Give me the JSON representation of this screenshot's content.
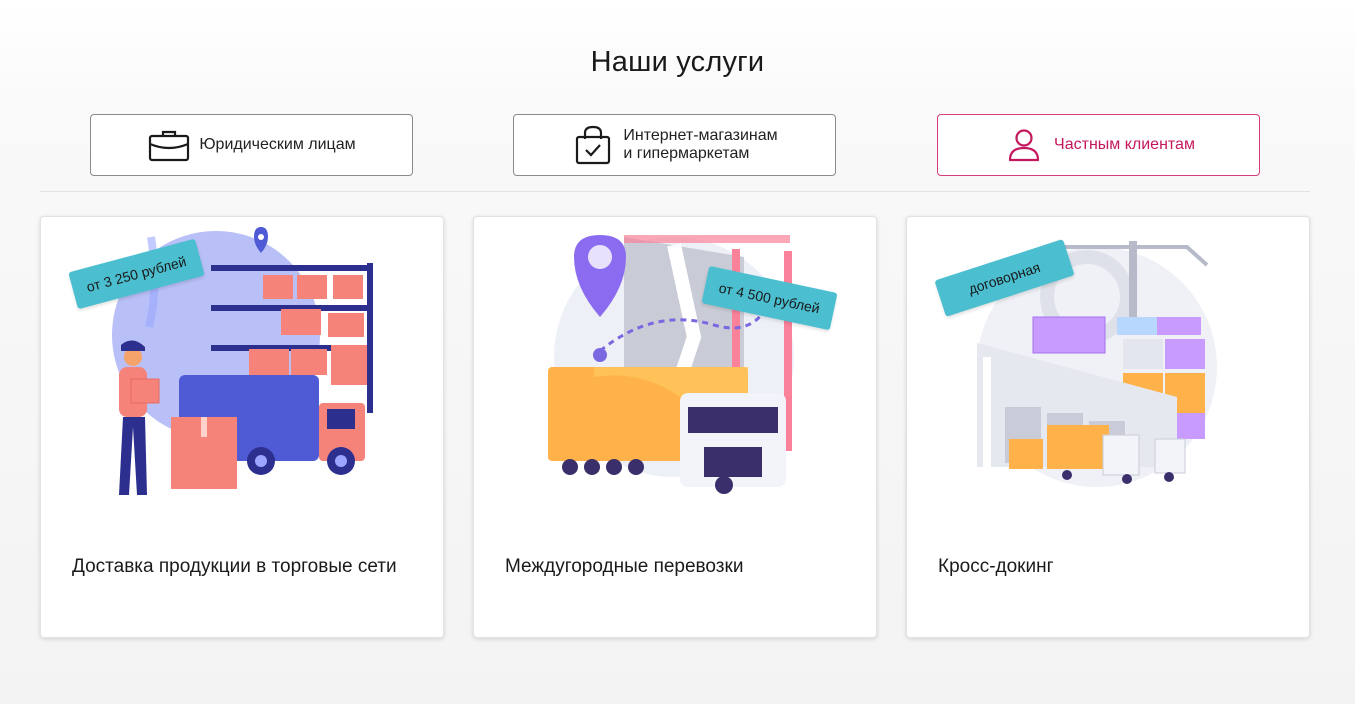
{
  "header": {
    "title": "Наши услуги"
  },
  "tabs": [
    {
      "label_line1": "Юридическим лицам",
      "label_line2": "",
      "icon": "briefcase-icon",
      "active": false
    },
    {
      "label_line1": "Интернет-магазинам",
      "label_line2": "и гипермаркетам",
      "icon": "shopping-bag-icon",
      "active": false
    },
    {
      "label_line1": "Частным клиентам",
      "label_line2": "",
      "icon": "user-icon",
      "active": true
    }
  ],
  "cards": [
    {
      "title": "Доставка продукции в торговые сети",
      "price": "от 3 250 рублей",
      "illustration": "warehouse-delivery-illustration"
    },
    {
      "title": "Междугородные перевозки",
      "price": "от 4 500 рублей",
      "illustration": "intercity-truck-illustration"
    },
    {
      "title": "Кросс-докинг",
      "price": "договорная",
      "illustration": "cross-docking-illustration"
    }
  ],
  "colors": {
    "accent": "#c4185d",
    "badge": "#4bbfd0",
    "border": "#8a8a8a"
  }
}
